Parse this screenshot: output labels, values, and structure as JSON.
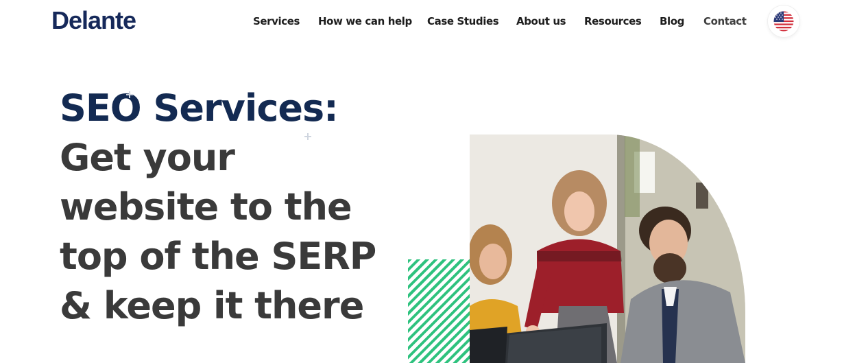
{
  "brand": {
    "logo": "Delante"
  },
  "nav": {
    "items": [
      {
        "label": "Services"
      },
      {
        "label": "How we can help"
      },
      {
        "label": "Case Studies"
      },
      {
        "label": "About us"
      },
      {
        "label": "Resources"
      },
      {
        "label": "Blog"
      },
      {
        "label": "Contact"
      }
    ],
    "language_icon": "us-flag-icon"
  },
  "hero": {
    "title_lines": [
      "SEO Services:",
      "Get your",
      "website to the",
      "top of the SERP",
      "& keep it there"
    ]
  },
  "colors": {
    "brand_navy": "#132a52",
    "heading_gray": "#3a3a3a",
    "accent_green": "#2ec27e"
  }
}
